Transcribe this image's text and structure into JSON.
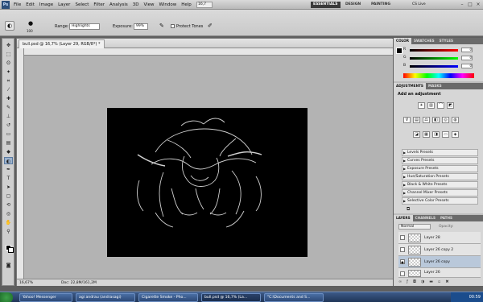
{
  "app": {
    "logo": "Ps",
    "menu": [
      "File",
      "Edit",
      "Image",
      "Layer",
      "Select",
      "Filter",
      "Analysis",
      "3D",
      "View",
      "Window",
      "Help"
    ],
    "zoom_select": "16,7",
    "workspaces": [
      "ESSENTIALS",
      "DESIGN",
      "PAINTING"
    ],
    "cs_live": "CS Live"
  },
  "options": {
    "brush_size": "100",
    "range_label": "Range:",
    "range_value": "Highlights",
    "exposure_label": "Exposure:",
    "exposure_value": "99%",
    "protect_tones": "Protect Tones"
  },
  "document": {
    "tab_title": "bull.psd @ 16,7% (Layer 29, RGB/8*) *",
    "zoom": "16,67%",
    "doc_size": "Doc: 22,8M/161,2M"
  },
  "panels": {
    "color_tabs": [
      "COLOR",
      "SWATCHES",
      "STYLES"
    ],
    "color_sliders": [
      {
        "label": "R",
        "value": "0",
        "color": "#d62020"
      },
      {
        "label": "G",
        "value": "0",
        "color": "#20b020"
      },
      {
        "label": "B",
        "value": "0",
        "color": "#2040d0"
      }
    ],
    "adjust_tabs": [
      "ADJUSTMENTS",
      "MASKS"
    ],
    "adjust_title": "Add an adjustment",
    "presets": [
      "Levels Presets",
      "Curves Presets",
      "Exposure Presets",
      "Hue/Saturation Presets",
      "Black & White Presets",
      "Channel Mixer Presets",
      "Selective Color Presets"
    ],
    "layers_tabs": [
      "LAYERS",
      "CHANNELS",
      "PATHS"
    ],
    "blend_mode": "Normal",
    "opacity_label": "Opacity:",
    "layers": [
      {
        "name": "Layer 28",
        "selected": false,
        "visible": false
      },
      {
        "name": "Layer 26 copy 2",
        "selected": false,
        "visible": false
      },
      {
        "name": "Layer 26 copy",
        "selected": true,
        "visible": true
      },
      {
        "name": "Layer 26",
        "selected": false,
        "visible": false
      }
    ]
  },
  "taskbar": {
    "items": [
      "Yahoo! Messenger",
      "agi andrau (andrasagi)",
      "Cigarette Smoke - Pho...",
      "bull.psd @ 16,7% (La...",
      "\"C:\\Documents and S..."
    ],
    "clock": "00:59"
  }
}
